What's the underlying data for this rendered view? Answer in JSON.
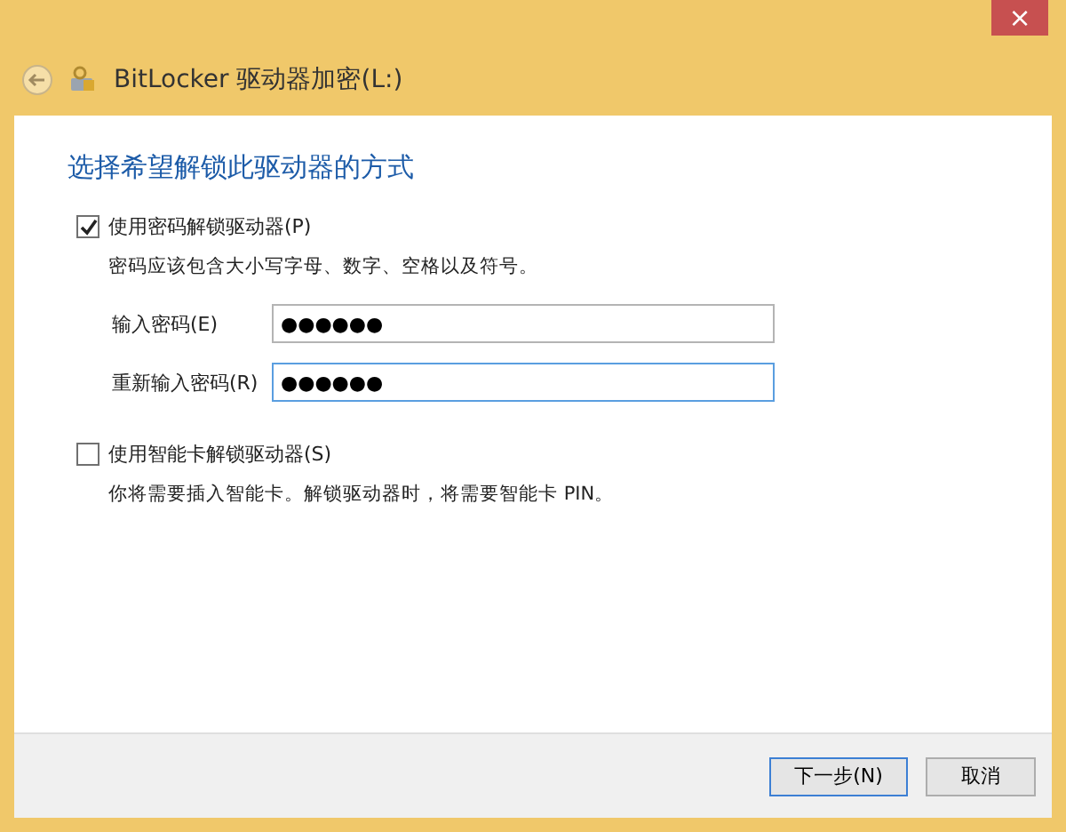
{
  "window": {
    "title": "BitLocker 驱动器加密(L:)",
    "close": "×"
  },
  "heading": "选择希望解锁此驱动器的方式",
  "options": [
    {
      "label": "使用密码解锁驱动器(P)",
      "checked": true,
      "description": "密码应该包含大小写字母、数字、空格以及符号。",
      "fields": [
        {
          "label": "输入密码(E)",
          "value": "●●●●●●",
          "focused": false
        },
        {
          "label": "重新输入密码(R)",
          "value": "●●●●●●",
          "focused": true
        }
      ]
    },
    {
      "label": "使用智能卡解锁驱动器(S)",
      "checked": false,
      "description": "你将需要插入智能卡。解锁驱动器时，将需要智能卡 PIN。"
    }
  ],
  "buttons": [
    {
      "label": "下一步(N)",
      "default": true
    },
    {
      "label": "取消",
      "default": false
    }
  ]
}
